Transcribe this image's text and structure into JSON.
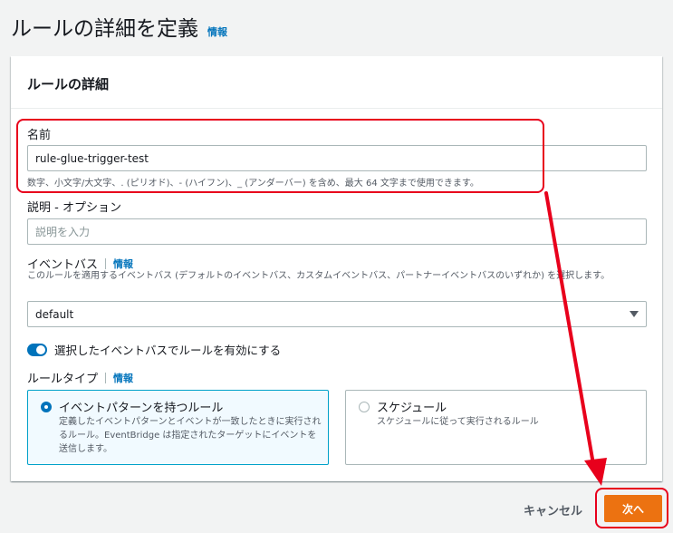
{
  "page": {
    "title": "ルールの詳細を定義",
    "info": "情報"
  },
  "panel": {
    "title": "ルールの詳細"
  },
  "name_field": {
    "label": "名前",
    "value": "rule-glue-trigger-test",
    "hint": "数字、小文字/大文字、. (ピリオド)、- (ハイフン)、_ (アンダーバー) を含め、最大 64 文字まで使用できます。"
  },
  "description_field": {
    "label": "説明 - オプション",
    "placeholder": "説明を入力"
  },
  "event_bus": {
    "label": "イベントバス",
    "info": "情報",
    "hint": "このルールを適用するイベントバス (デフォルトのイベントバス、カスタムイベントバス、パートナーイベントバスのいずれか) を選択します。",
    "selected": "default"
  },
  "toggle": {
    "label": "選択したイベントバスでルールを有効にする",
    "enabled": true
  },
  "rule_type": {
    "label": "ルールタイプ",
    "info": "情報",
    "options": [
      {
        "title": "イベントパターンを持つルール",
        "description": "定義したイベントパターンとイベントが一致したときに実行されるルール。EventBridge は指定されたターゲットにイベントを送信します。",
        "selected": true
      },
      {
        "title": "スケジュール",
        "description": "スケジュールに従って実行されるルール",
        "selected": false
      }
    ]
  },
  "footer": {
    "cancel": "キャンセル",
    "next": "次へ"
  },
  "colors": {
    "accent": "#0073bb",
    "primary_button": "#ec7211",
    "annotation": "#e8001c"
  }
}
